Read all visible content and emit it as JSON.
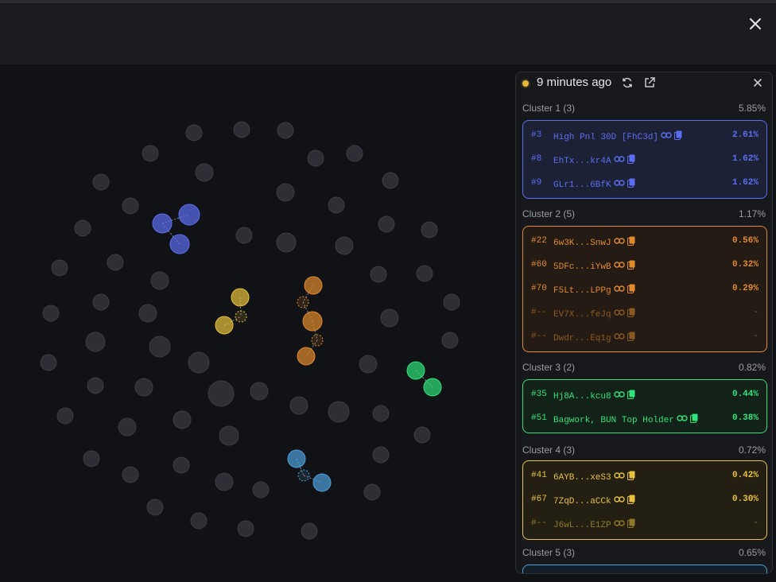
{
  "panel": {
    "updated": "9 minutes ago",
    "icons": {
      "status": "status-dot",
      "refresh": "refresh-icon",
      "open": "external-link-icon",
      "close": "close-icon"
    }
  },
  "colors": {
    "cluster1": "#5b6ef0",
    "cluster2": "#e08a2c",
    "cluster3": "#2ee37a",
    "cluster4": "#e8c23c",
    "cluster5": "#4a9fd8",
    "neutral_bubble": "#2d2f35"
  },
  "clusters": [
    {
      "label": "Cluster 1 (3)",
      "pct": "5.85%",
      "rows": [
        {
          "rank": "#3",
          "name": "High Pnl 30D [FhC3d]",
          "pct": "2.61%"
        },
        {
          "rank": "#8",
          "name": "EhTx...kr4A",
          "pct": "1.62%"
        },
        {
          "rank": "#9",
          "name": "GLr1...6BfK",
          "pct": "1.62%"
        }
      ]
    },
    {
      "label": "Cluster 2 (5)",
      "pct": "1.17%",
      "rows": [
        {
          "rank": "#22",
          "name": "6w3K...SnwJ",
          "pct": "0.56%"
        },
        {
          "rank": "#60",
          "name": "5DFc...iYwB",
          "pct": "0.32%"
        },
        {
          "rank": "#70",
          "name": "F5Lt...LPPg",
          "pct": "0.29%"
        },
        {
          "rank": "#--",
          "name": "EV7X...feJq",
          "pct": "-"
        },
        {
          "rank": "#--",
          "name": "Dwdr...Eq1g",
          "pct": "-"
        }
      ]
    },
    {
      "label": "Cluster 3 (2)",
      "pct": "0.82%",
      "rows": [
        {
          "rank": "#35",
          "name": "Hj8A...kcu8",
          "pct": "0.44%"
        },
        {
          "rank": "#51",
          "name": "Bagwork, BUN Top Holder",
          "pct": "0.38%"
        }
      ]
    },
    {
      "label": "Cluster 4 (3)",
      "pct": "0.72%",
      "rows": [
        {
          "rank": "#41",
          "name": "6AYB...xeS3",
          "pct": "0.42%"
        },
        {
          "rank": "#67",
          "name": "7ZqD...aCCk",
          "pct": "0.30%"
        },
        {
          "rank": "#--",
          "name": "J6wL...E1ZP",
          "pct": "-"
        }
      ]
    },
    {
      "label": "Cluster 5 (3)",
      "pct": "0.65%",
      "rows": []
    }
  ]
}
